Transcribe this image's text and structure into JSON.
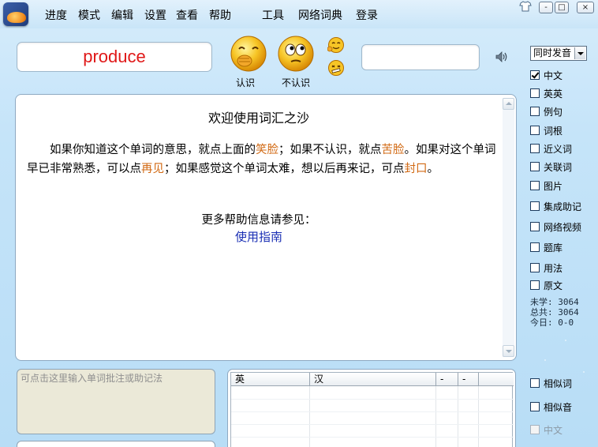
{
  "menu": {
    "items": [
      "进度",
      "模式",
      "编辑",
      "设置",
      "查看",
      "帮助",
      "工具",
      "网络词典",
      "登录"
    ]
  },
  "window_controls": {
    "minimize": "-",
    "restore": "□",
    "close": "×"
  },
  "word": {
    "current": "produce"
  },
  "buttons": {
    "know_label": "认识",
    "unknown_label": "不认识"
  },
  "search": {
    "value": "",
    "placeholder": ""
  },
  "voice_select": {
    "selected": "同时发音"
  },
  "options": [
    {
      "label": "中文",
      "checked": true
    },
    {
      "label": "英英",
      "checked": false
    },
    {
      "label": "例句",
      "checked": false
    },
    {
      "label": "词根",
      "checked": false
    },
    {
      "label": "近义词",
      "checked": false
    },
    {
      "label": "关联词",
      "checked": false
    },
    {
      "label": "图片",
      "checked": false
    },
    {
      "label": "集成助记",
      "checked": false
    },
    {
      "label": "网络视频",
      "checked": false
    },
    {
      "label": "题库",
      "checked": false
    },
    {
      "label": "用法",
      "checked": false
    },
    {
      "label": "原文",
      "checked": false
    }
  ],
  "stats": {
    "unlearned": "未学: 3064",
    "total": "总共: 3064",
    "today": "今日: 0-0"
  },
  "main": {
    "title": "欢迎使用词汇之沙",
    "para_1": "如果你知道这个单词的意思，就点上面的",
    "smile": "笑脸",
    "para_2": "；如果不认识，就点",
    "bitter": "苦脸",
    "para_3": "。如果对这个单词早已非常熟悉，可以点",
    "bye": "再见",
    "para_4": "；如果感觉这个单词太难，想以后再来记，可点",
    "seal": "封口",
    "para_5": "。",
    "more_help": "更多帮助信息请参见：",
    "guide_link": "使用指南"
  },
  "note": {
    "placeholder": "可点击这里输入单词批注或助记法"
  },
  "table": {
    "headers": [
      "英",
      "汉",
      "-",
      "-"
    ]
  },
  "bottom_options": [
    {
      "label": "相似词",
      "checked": false,
      "disabled": false
    },
    {
      "label": "相似音",
      "checked": false,
      "disabled": false
    },
    {
      "label": "中文",
      "checked": false,
      "disabled": true
    }
  ],
  "colors": {
    "word_text": "#e01818",
    "highlight": "#d26a14",
    "link": "#1a2fb4",
    "background": "#c5e4f9"
  }
}
